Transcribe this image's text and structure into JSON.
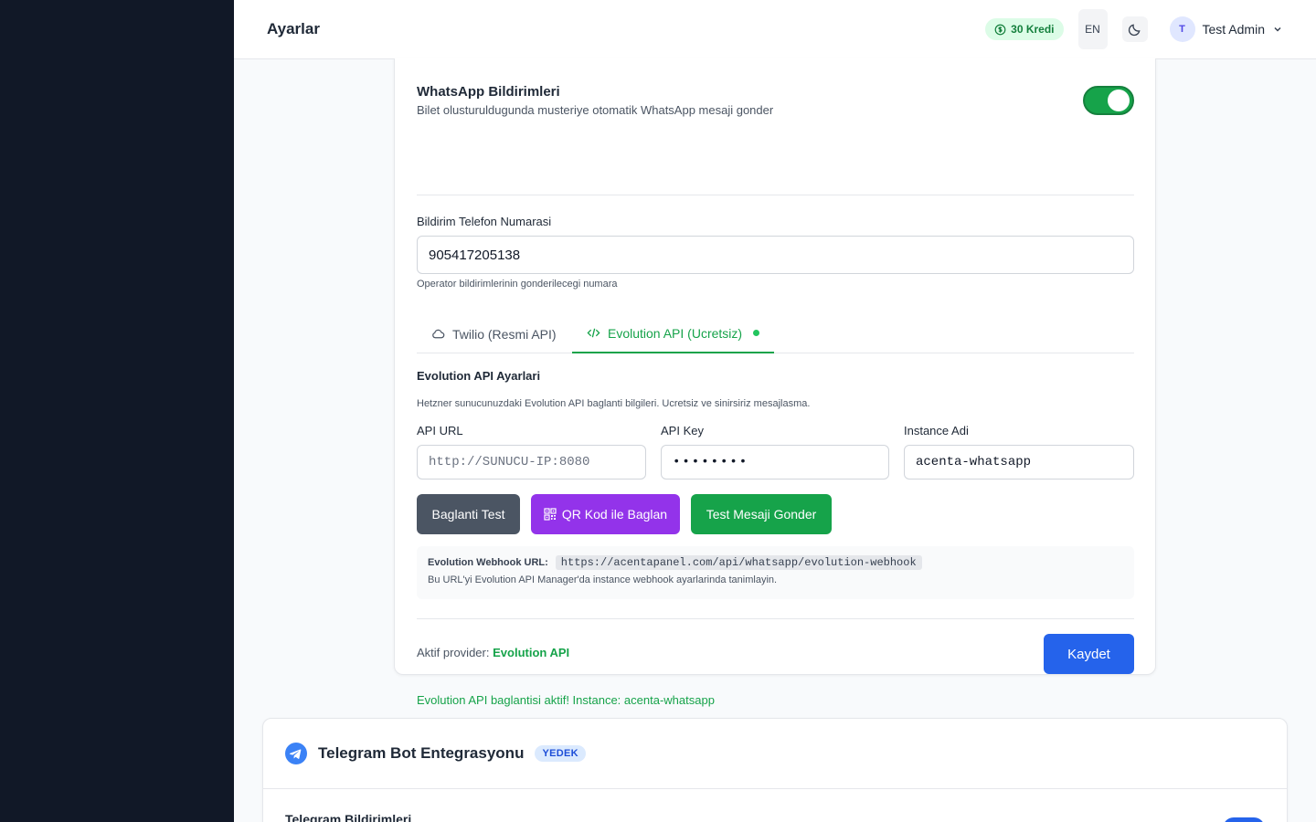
{
  "header": {
    "title": "Ayarlar",
    "credits": "30 Kredi",
    "language": "EN",
    "user_initial": "T",
    "user_name": "Test Admin"
  },
  "whatsapp": {
    "title": "WhatsApp Bildirimleri",
    "description": "Bilet olusturuldugunda musteriye otomatik WhatsApp mesaji gonder",
    "enabled": true,
    "phone_label": "Bildirim Telefon Numarasi",
    "phone_value": "905417205138",
    "phone_hint": "Operator bildirimlerinin gonderilecegi numara",
    "tabs": [
      {
        "label": "Twilio (Resmi API)",
        "active": false
      },
      {
        "label": "Evolution API (Ucretsiz)",
        "active": true
      }
    ],
    "section_title": "Evolution API Ayarlari",
    "section_desc": "Hetzner sunucunuzdaki Evolution API baglanti bilgileri. Ucretsiz ve sinirsiriz mesajlasma.",
    "api_url_label": "API URL",
    "api_url_placeholder": "http://SUNUCU-IP:8080",
    "api_key_label": "API Key",
    "api_key_value": "••••••••",
    "instance_label": "Instance Adi",
    "instance_value": "acenta-whatsapp",
    "buttons": {
      "test_connection": "Baglanti Test",
      "qr_connect": "QR Kod ile Baglan",
      "send_test": "Test Mesaji Gonder",
      "save": "Kaydet"
    },
    "webhook_label": "Evolution Webhook URL:",
    "webhook_url": "https://acentapanel.com/api/whatsapp/evolution-webhook",
    "webhook_note": "Bu URL'yi Evolution API Manager'da instance webhook ayarlarinda tanimlayin.",
    "provider_prefix": "Aktif provider:",
    "provider_name": "Evolution API",
    "status_message": "Evolution API baglantisi aktif! Instance: acenta-whatsapp"
  },
  "telegram": {
    "title": "Telegram Bot Entegrasyonu",
    "badge": "YEDEK",
    "subtitle": "Telegram Bildirimleri"
  },
  "colors": {
    "sidebar": "#111827",
    "accent_green": "#16a34a",
    "primary_blue": "#2563eb",
    "purple": "#9333ea"
  }
}
